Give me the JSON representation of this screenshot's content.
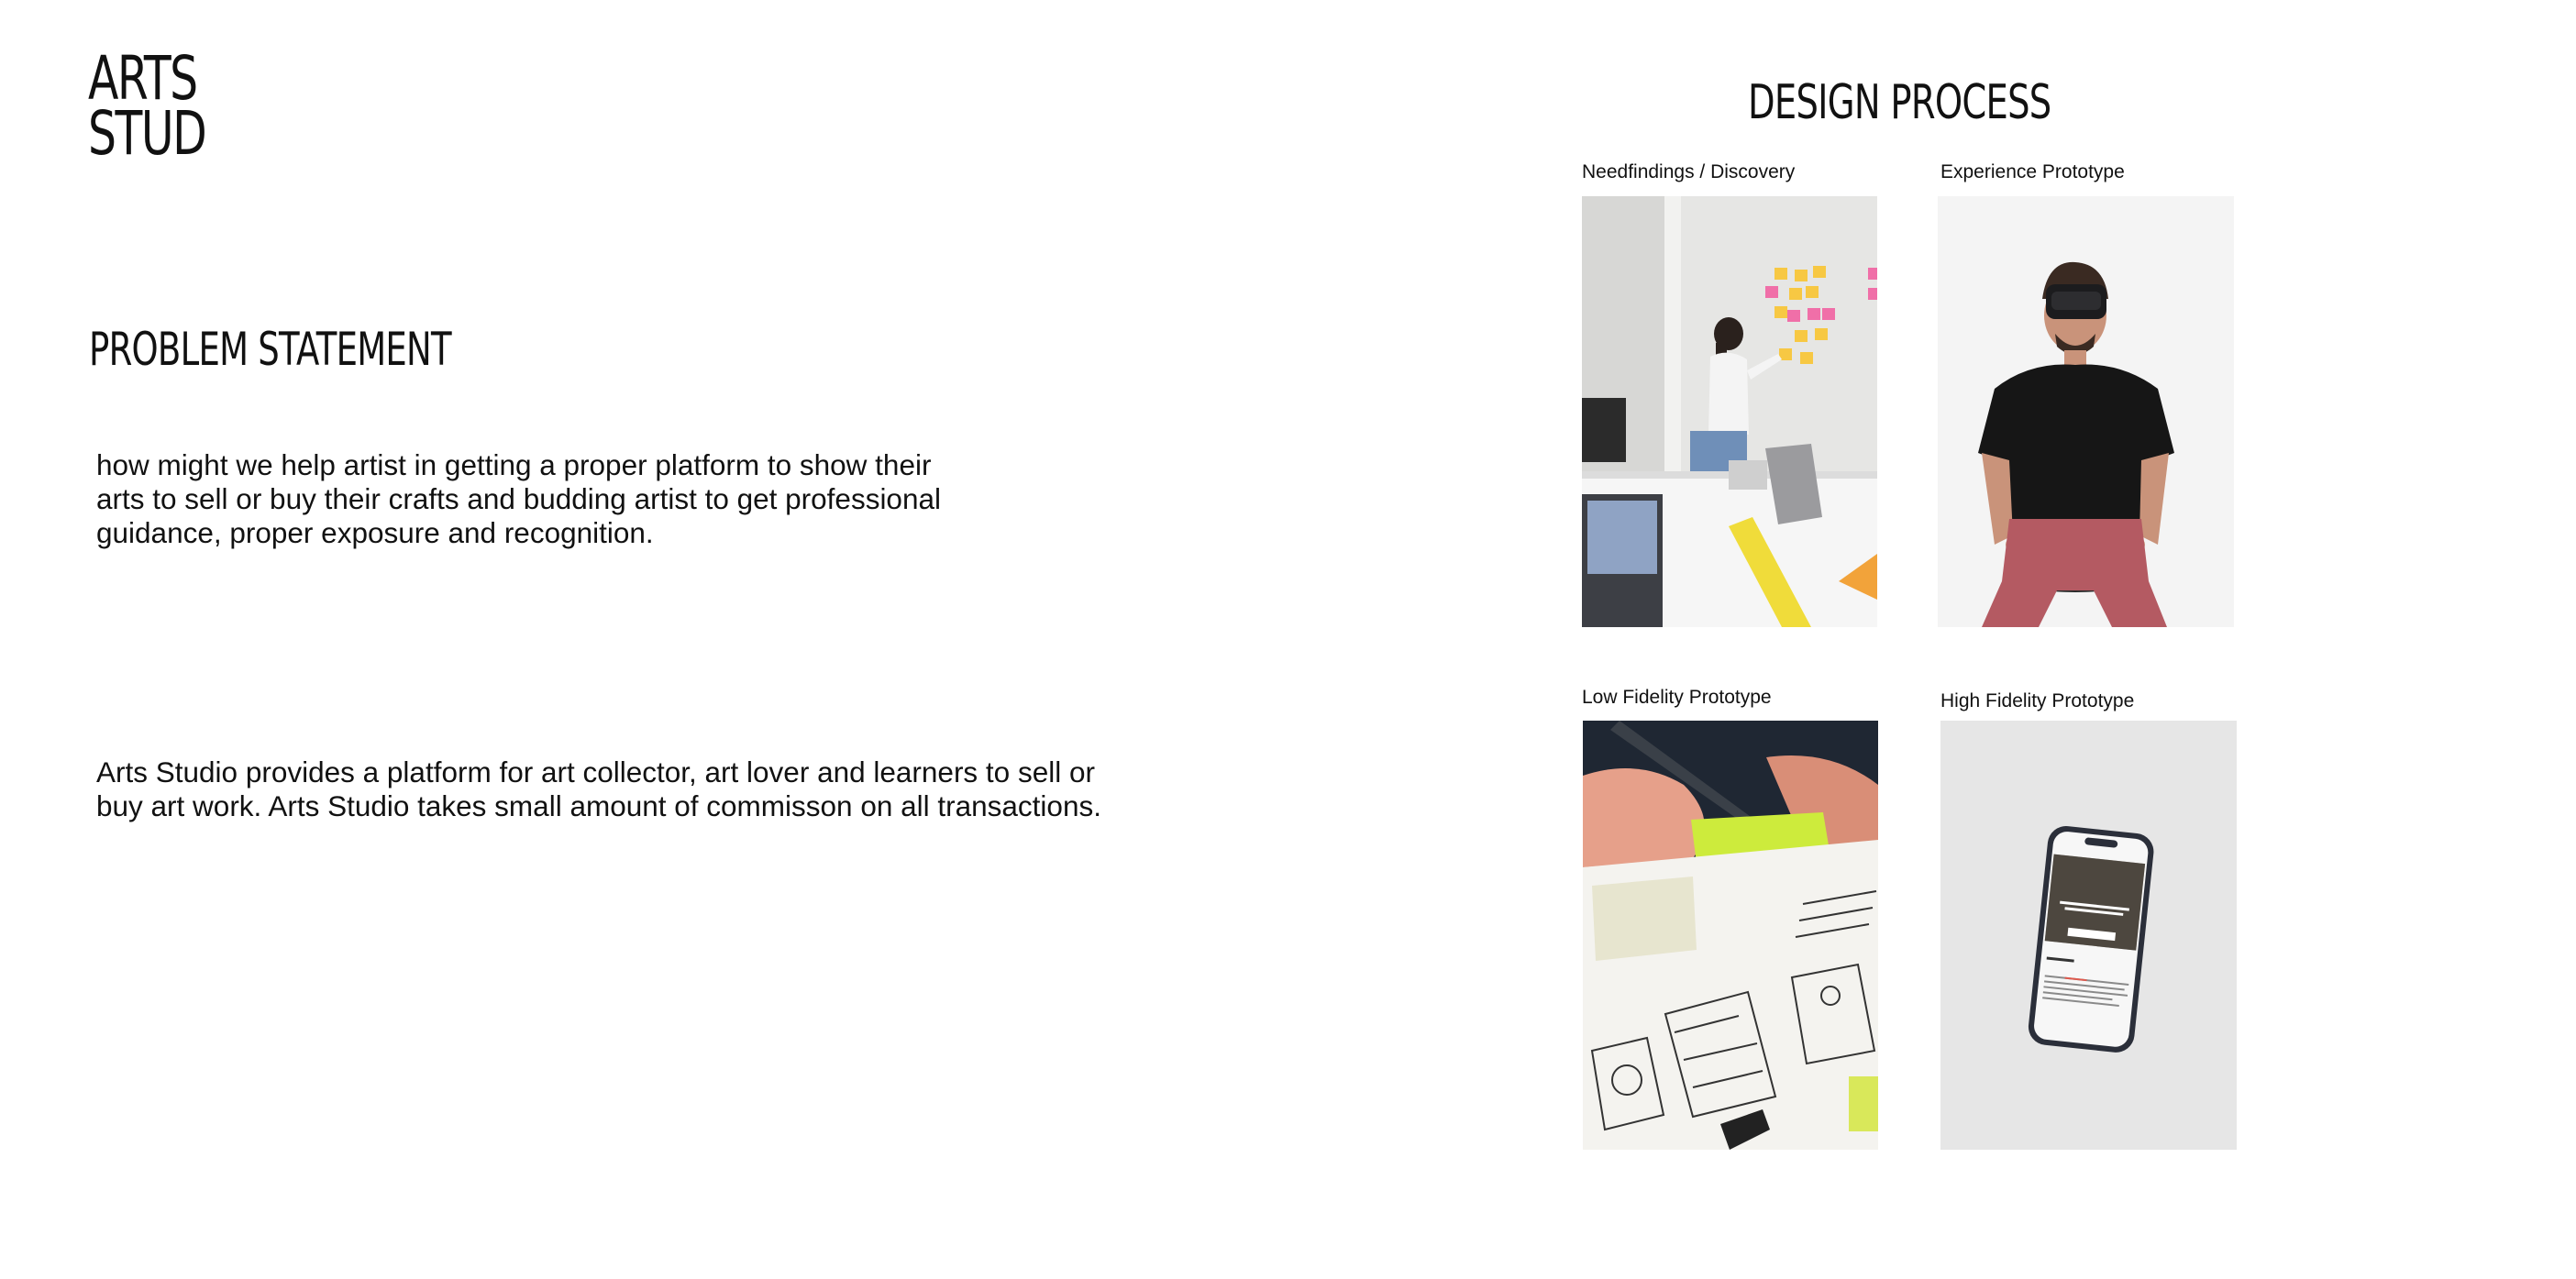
{
  "brand": {
    "line1": "ARTS",
    "line2": "STUD"
  },
  "problem": {
    "title": "PROBLEM STATEMENT",
    "statement": "how might we help artist in getting a proper platform to show their arts to sell or buy their crafts and budding artist to get professional guidance, proper exposure and recognition.",
    "solution": "Arts Studio provides a platform for art collector, art lover and learners to sell or buy art work. Arts Studio takes small amount of commisson on all transactions."
  },
  "process": {
    "title": "DESIGN PROCESS",
    "steps": [
      {
        "caption": "Needfindings / Discovery"
      },
      {
        "caption": "Experience Prototype"
      },
      {
        "caption": "Low Fidelity Prototype"
      },
      {
        "caption": "High Fidelity Prototype"
      }
    ]
  }
}
